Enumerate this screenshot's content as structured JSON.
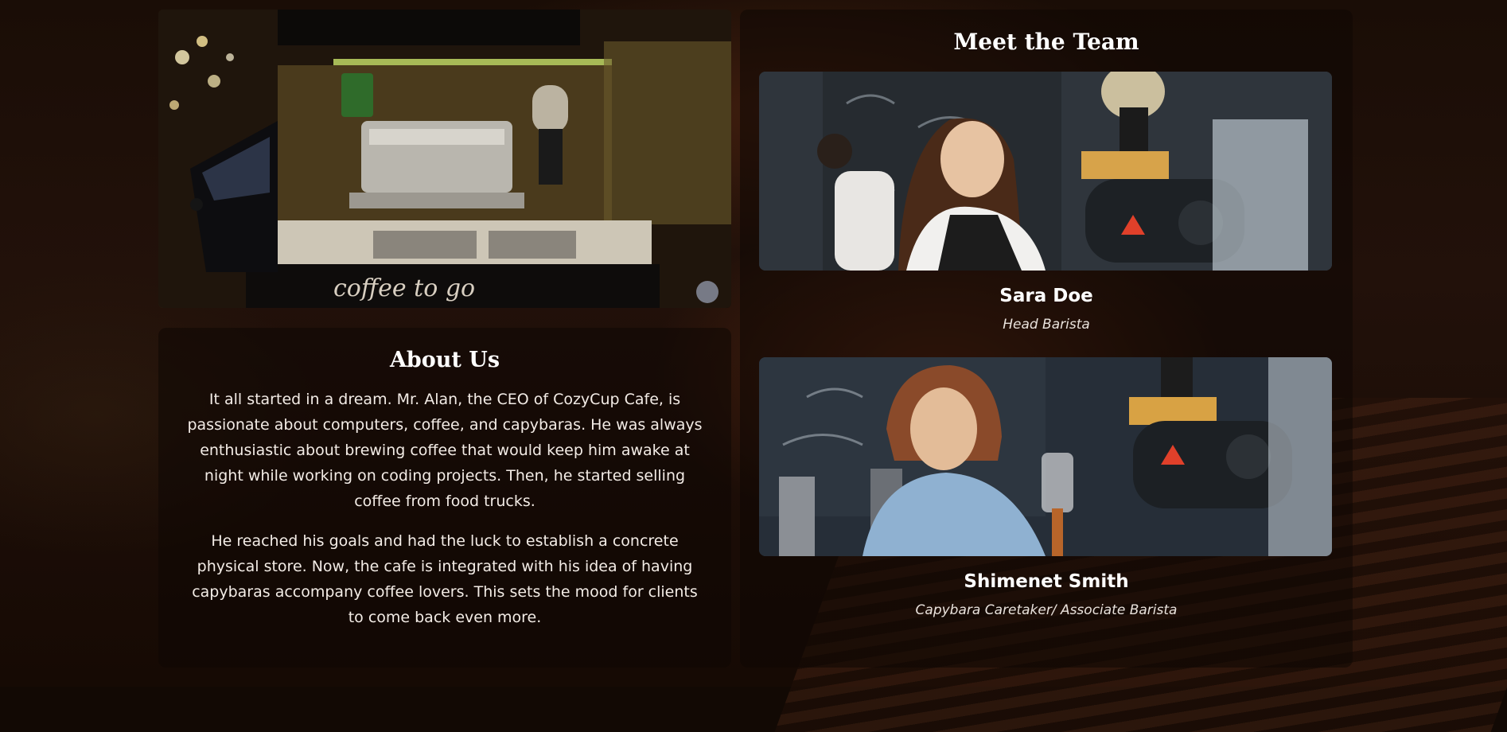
{
  "about": {
    "title": "About Us",
    "paragraphs": [
      "It all started in a dream. Mr. Alan, the CEO of CozyCup Cafe, is passionate about computers, coffee, and capybaras. He was always enthusiastic about brewing coffee that would keep him awake at night while working on coding projects. Then, he started selling coffee from food trucks.",
      "He reached his goals and had the luck to establish a concrete physical store. Now, the cafe is integrated with his idea of having capybaras accompany coffee lovers. This sets the mood for clients to come back even more."
    ]
  },
  "hero_photo": {
    "sign_text": "coffee to go"
  },
  "team": {
    "title": "Meet the Team",
    "members": [
      {
        "name": "Sara Doe",
        "role": "Head Barista"
      },
      {
        "name": "Shimenet Smith",
        "role": "Capybara Caretaker/ Associate Barista"
      }
    ]
  }
}
